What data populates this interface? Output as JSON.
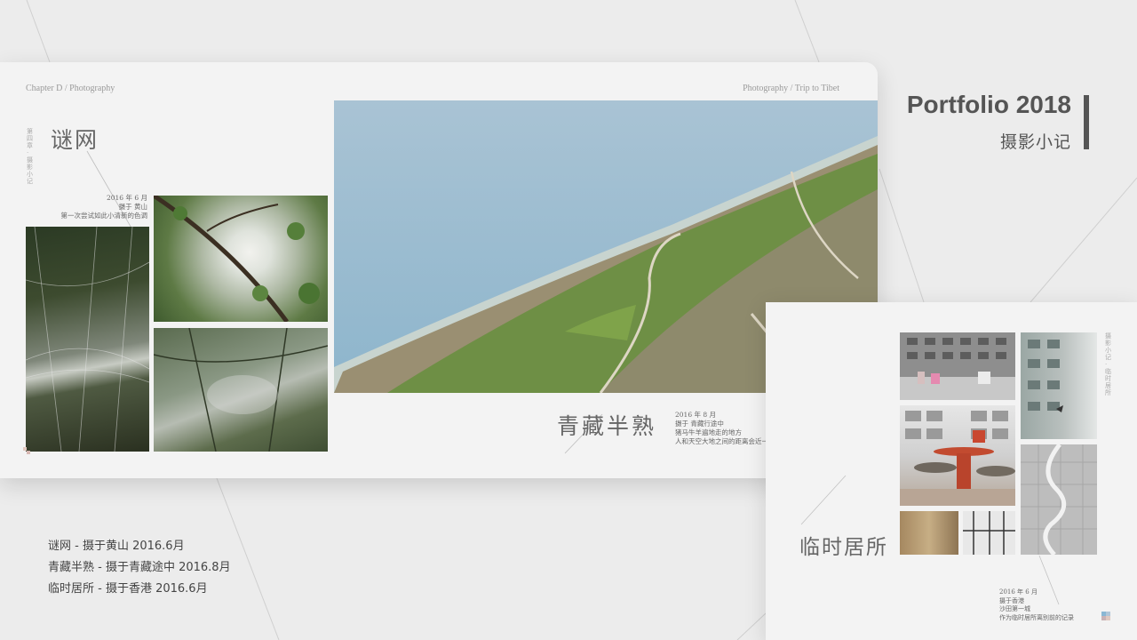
{
  "main_card": {
    "breadcrumb_left": "Chapter D / Photography",
    "breadcrumb_right": "Photography / Trip to Tibet",
    "vertical_tiny": "第四章·摄影小记",
    "section_1": {
      "title": "谜网",
      "caption": [
        "2016 年 6 月",
        "摄于 黄山",
        "第一次尝试如此小清新的色调"
      ]
    },
    "section_2": {
      "title": "青藏半熟",
      "caption": [
        "2016 年 8 月",
        "摄于 青藏行途中",
        "猪马牛羊遍地走的地方",
        "人和天空大地之间的距离会近一些"
      ]
    }
  },
  "header": {
    "title": "Portfolio 2018",
    "subtitle": "摄影小记"
  },
  "second_card": {
    "vertical_tiny": "摄影小记·临时居所",
    "title": "临时居所",
    "caption": [
      "2016 年 6 月",
      "摄于香港",
      "沙田第一城",
      "作为临时居所离别前的记录"
    ]
  },
  "photo_list": [
    "谜网 - 摄于黄山 2016.6月",
    "青藏半熟 - 摄于青藏途中 2016.8月",
    "临时居所 - 摄于香港 2016.6月"
  ],
  "colors": {
    "background": "#ececec",
    "card": "#f3f3f3",
    "text": "#555555",
    "logo": [
      "#8ab7d4",
      "#c9b2b5",
      "#b0c6d8",
      "#e0c9c0"
    ]
  },
  "icons": [
    "logo-mark"
  ]
}
